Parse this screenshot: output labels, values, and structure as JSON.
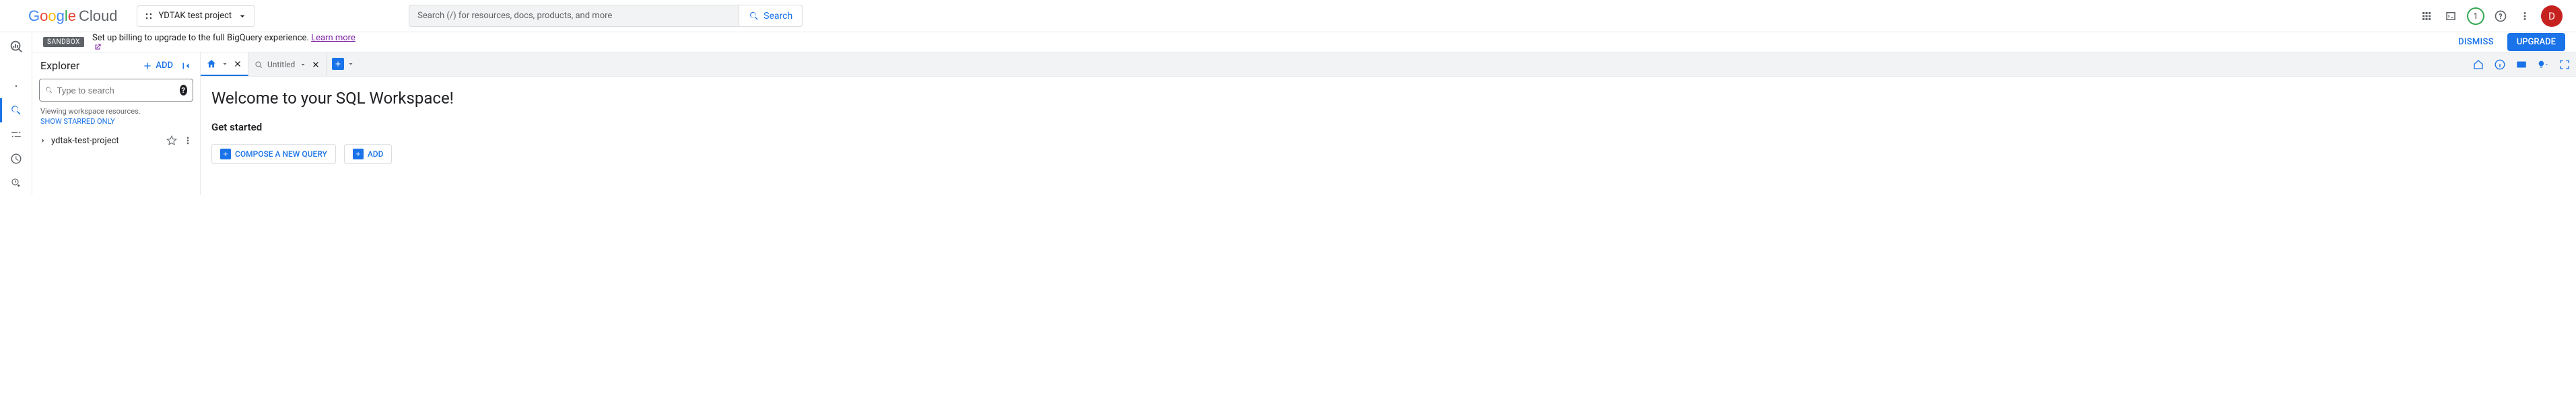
{
  "header": {
    "cloud_word": "Cloud",
    "project_name": "YDTAK test project",
    "search_placeholder": "Search (/) for resources, docs, products, and more",
    "search_button": "Search",
    "notification_count": "1",
    "avatar_initial": "D"
  },
  "banner": {
    "chip": "SANDBOX",
    "text": "Set up billing to upgrade to the full BigQuery experience.",
    "link": "Learn more",
    "dismiss": "DISMISS",
    "upgrade": "UPGRADE"
  },
  "explorer": {
    "title": "Explorer",
    "add": "ADD",
    "search_placeholder": "Type to search",
    "viewing": "Viewing workspace resources.",
    "show_starred": "SHOW STARRED ONLY",
    "tree": {
      "project": "ydtak-test-project"
    }
  },
  "tabs": {
    "untitled": "Untitled"
  },
  "welcome": {
    "heading": "Welcome to your SQL Workspace!",
    "subheading": "Get started",
    "compose": "COMPOSE A NEW QUERY",
    "add": "ADD"
  }
}
